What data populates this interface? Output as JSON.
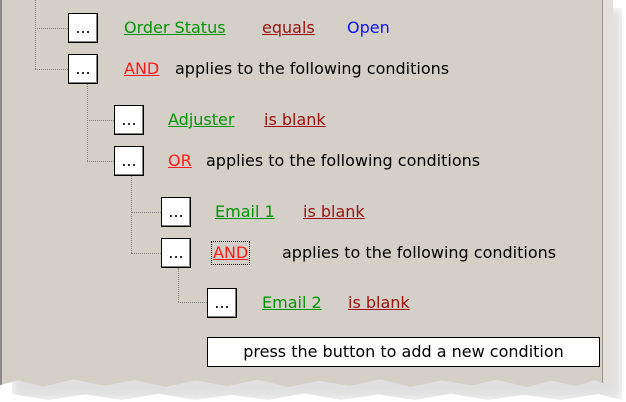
{
  "tree": {
    "row1": {
      "button_label": "...",
      "field": "Order Status",
      "operator": "equals",
      "value": "Open"
    },
    "row2": {
      "button_label": "...",
      "logic": "AND",
      "text": "applies to the following conditions"
    },
    "row3": {
      "button_label": "...",
      "field": "Adjuster",
      "operator": "is blank"
    },
    "row4": {
      "button_label": "...",
      "logic": "OR",
      "text": "applies to the following conditions"
    },
    "row5": {
      "button_label": "...",
      "field": "Email 1",
      "operator": "is blank"
    },
    "row6": {
      "button_label": "...",
      "logic": "AND",
      "text": "applies to the following conditions"
    },
    "row7": {
      "button_label": "...",
      "field": "Email 2",
      "operator": "is blank"
    },
    "add_condition_hint": "press the button to add a new condition"
  },
  "colors": {
    "field": "#079307",
    "operator": "#9b1111",
    "logic": "#ff1a1a",
    "value": "#1010ff",
    "background": "#d4d0c8"
  }
}
